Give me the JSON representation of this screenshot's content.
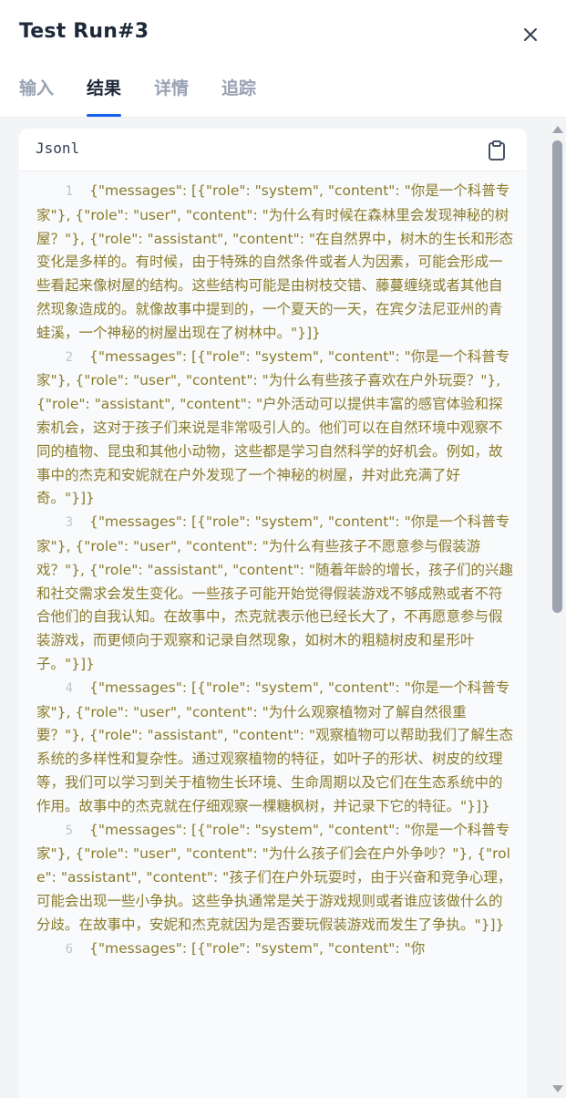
{
  "header": {
    "title": "Test Run#3",
    "close_icon": "close-icon"
  },
  "tabs": [
    {
      "label": "输入",
      "active": false
    },
    {
      "label": "结果",
      "active": true
    },
    {
      "label": "详情",
      "active": false
    },
    {
      "label": "追踪",
      "active": false
    }
  ],
  "result": {
    "format_label": "Jsonl",
    "copy_icon": "clipboard-icon",
    "lines": [
      {
        "num": "1",
        "text": "{\"messages\": [{\"role\": \"system\", \"content\": \"你是一个科普专家\"}, {\"role\": \"user\", \"content\": \"为什么有时候在森林里会发现神秘的树屋？\"}, {\"role\": \"assistant\", \"content\": \"在自然界中，树木的生长和形态变化是多样的。有时候，由于特殊的自然条件或者人为因素，可能会形成一些看起来像树屋的结构。这些结构可能是由树枝交错、藤蔓缠绕或者其他自然现象造成的。就像故事中提到的，一个夏天的一天，在宾夕法尼亚州的青蛙溪，一个神秘的树屋出现在了树林中。\"}]}"
      },
      {
        "num": "2",
        "text": "{\"messages\": [{\"role\": \"system\", \"content\": \"你是一个科普专家\"}, {\"role\": \"user\", \"content\": \"为什么有些孩子喜欢在户外玩耍？\"}, {\"role\": \"assistant\", \"content\": \"户外活动可以提供丰富的感官体验和探索机会，这对于孩子们来说是非常吸引人的。他们可以在自然环境中观察不同的植物、昆虫和其他小动物，这些都是学习自然科学的好机会。例如，故事中的杰克和安妮就在户外发现了一个神秘的树屋，并对此充满了好奇。\"}]}"
      },
      {
        "num": "3",
        "text": "{\"messages\": [{\"role\": \"system\", \"content\": \"你是一个科普专家\"}, {\"role\": \"user\", \"content\": \"为什么有些孩子不愿意参与假装游戏？\"}, {\"role\": \"assistant\", \"content\": \"随着年龄的增长，孩子们的兴趣和社交需求会发生变化。一些孩子可能开始觉得假装游戏不够成熟或者不符合他们的自我认知。在故事中，杰克就表示他已经长大了，不再愿意参与假装游戏，而更倾向于观察和记录自然现象，如树木的粗糙树皮和星形叶子。\"}]}"
      },
      {
        "num": "4",
        "text": "{\"messages\": [{\"role\": \"system\", \"content\": \"你是一个科普专家\"}, {\"role\": \"user\", \"content\": \"为什么观察植物对了解自然很重要？\"}, {\"role\": \"assistant\", \"content\": \"观察植物可以帮助我们了解生态系统的多样性和复杂性。通过观察植物的特征，如叶子的形状、树皮的纹理等，我们可以学习到关于植物生长环境、生命周期以及它们在生态系统中的作用。故事中的杰克就在仔细观察一棵糖枫树，并记录下它的特征。\"}]}"
      },
      {
        "num": "5",
        "text": "{\"messages\": [{\"role\": \"system\", \"content\": \"你是一个科普专家\"}, {\"role\": \"user\", \"content\": \"为什么孩子们会在户外争吵？\"}, {\"role\": \"assistant\", \"content\": \"孩子们在户外玩耍时，由于兴奋和竞争心理，可能会出现一些小争执。这些争执通常是关于游戏规则或者谁应该做什么的分歧。在故事中，安妮和杰克就因为是否要玩假装游戏而发生了争执。\"}]}"
      },
      {
        "num": "6",
        "text": "{\"messages\": [{\"role\": \"system\", \"content\": \"你"
      }
    ]
  },
  "colors": {
    "accent": "#155eef",
    "code_text": "#8a7b2c",
    "line_number": "#c0c4cc"
  }
}
